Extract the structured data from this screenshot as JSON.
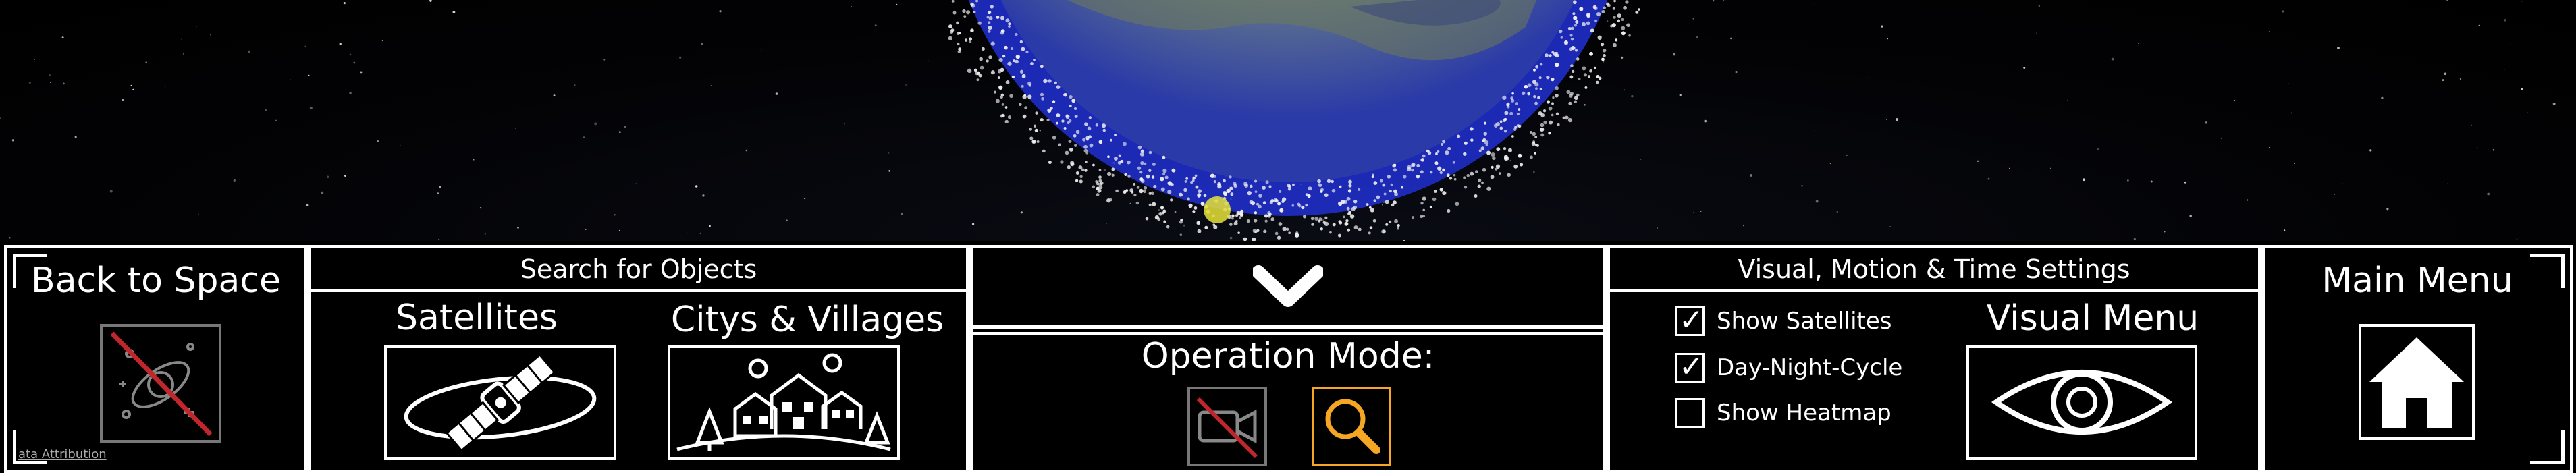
{
  "back_panel": {
    "title": "Back to Space",
    "icon": "galaxy-crossed-icon",
    "attribution": "ata Attribution"
  },
  "search_panel": {
    "title": "Search for Objects",
    "satellites_label": "Satellites",
    "satellites_icon": "satellite-icon",
    "cities_label": "Citys & Villages",
    "cities_icon": "village-icon"
  },
  "center_panel": {
    "collapse_icon": "chevron-down-icon",
    "operation_label": "Operation Mode:",
    "camera_icon": "camera-off-icon",
    "search_icon": "magnifier-icon",
    "accent": "#f5a623"
  },
  "settings_panel": {
    "title": "Visual, Motion & Time Settings",
    "checkboxes": [
      {
        "label": "Show Satellites",
        "checked": true
      },
      {
        "label": "Day-Night-Cycle",
        "checked": true
      },
      {
        "label": "Show Heatmap",
        "checked": false
      }
    ],
    "visual_menu_label": "Visual Menu",
    "visual_icon": "eye-icon"
  },
  "menu_panel": {
    "title": "Main Menu",
    "icon": "home-icon"
  }
}
